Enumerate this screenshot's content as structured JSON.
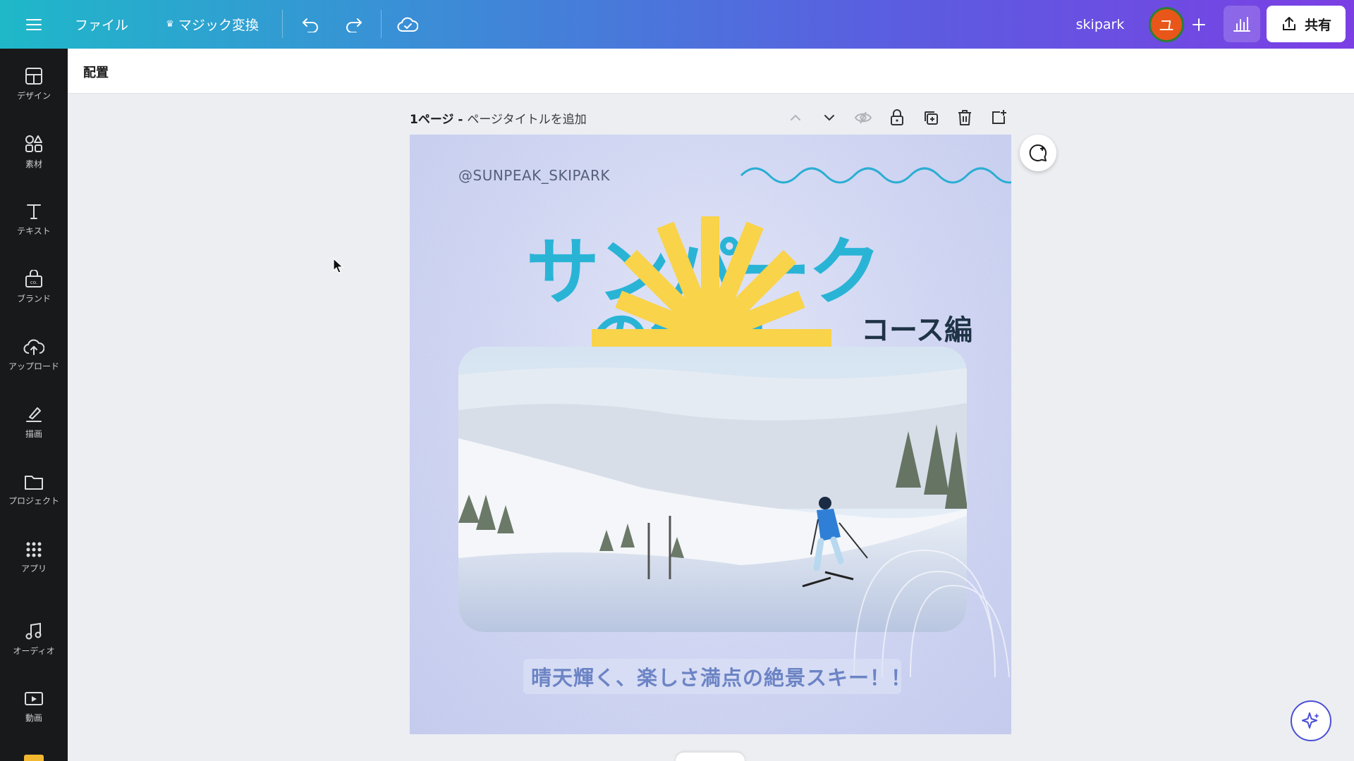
{
  "topbar": {
    "file_label": "ファイル",
    "magic_label": "マジック変換",
    "project_name": "skipark",
    "avatar_initial": "ユ",
    "share_label": "共有"
  },
  "sidebar": {
    "items": [
      {
        "label": "デザイン",
        "icon": "layout-icon"
      },
      {
        "label": "素材",
        "icon": "elements-icon"
      },
      {
        "label": "テキスト",
        "icon": "text-icon"
      },
      {
        "label": "ブランド",
        "icon": "brand-icon"
      },
      {
        "label": "アップロード",
        "icon": "upload-icon"
      },
      {
        "label": "描画",
        "icon": "draw-icon"
      },
      {
        "label": "プロジェクト",
        "icon": "folder-icon"
      },
      {
        "label": "アプリ",
        "icon": "apps-icon"
      },
      {
        "label": "オーディオ",
        "icon": "music-icon"
      },
      {
        "label": "動画",
        "icon": "video-icon"
      }
    ]
  },
  "subbar": {
    "arrange_label": "配置"
  },
  "page": {
    "number_label": "1ページ - ",
    "title_placeholder": "ページタイトルを追加"
  },
  "canvas": {
    "handle": "@SUNPEAK_SKIPARK",
    "title_line1": "サンパーク",
    "title_line2": "の絶景",
    "course": "コース編",
    "caption": "晴天輝く、楽しさ満点の絶景スキー！！"
  },
  "colors": {
    "title": "#29b4d6",
    "sun": "#f9d349",
    "caption": "#6c84c5",
    "brand_gradient_start": "#1fb8c9",
    "brand_gradient_end": "#7b3fe4"
  }
}
